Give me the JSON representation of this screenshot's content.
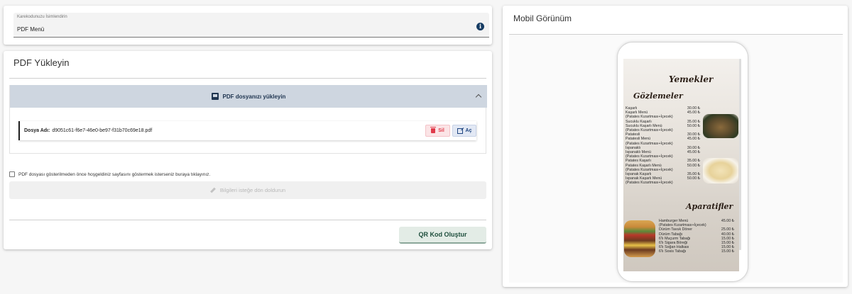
{
  "name_field": {
    "label": "Karekodunuzu İsimlendirin",
    "value": "PDF Menü"
  },
  "upload_card": {
    "title": "PDF Yükleyin",
    "accordion_label": "PDF dosyanızı yükleyin",
    "file_label": "Dosya Adı:",
    "file_name": "d9051c61-f6e7-46e0-be97-f31b70c69e18.pdf",
    "delete_label": "Sil",
    "open_label": "Aç",
    "checkbox_label": "PDF dosyası gösterilmeden önce hoşgeldiniz sayfasını göstermek isterseniz buraya tıklayınız.",
    "welcome_button_label": "Bilgileri isteğe dön doldurun",
    "qr_button_label": "QR Kod Oluştur"
  },
  "mobile_card": {
    "title": "Mobil Görünüm",
    "preview": {
      "heading_main": "Yemekler",
      "section1_title": "Gözlemeler",
      "section1_items": [
        {
          "name": "Kaşarlı",
          "price": "30.00 ₺"
        },
        {
          "name": "Kaşarlı Menü",
          "price": "45.00 ₺"
        },
        {
          "name": "(Patates Kızartması+İçecek)",
          "price": ""
        },
        {
          "name": "Sucuklu Kaşarlı",
          "price": "35.00 ₺"
        },
        {
          "name": "Sucuklu Kaşarlı Menü",
          "price": "50.00 ₺"
        },
        {
          "name": "(Patates Kızartması+İçecek)",
          "price": ""
        },
        {
          "name": "Patatesli",
          "price": "30.00 ₺"
        },
        {
          "name": "Patatesli Menü",
          "price": "45.00 ₺"
        },
        {
          "name": "(Patates Kızartması+İçecek)",
          "price": ""
        },
        {
          "name": "Ispanaklı",
          "price": "30.00 ₺"
        },
        {
          "name": "Ispanaklı Menü",
          "price": "45.00 ₺"
        },
        {
          "name": "(Patates Kızartması+İçecek)",
          "price": ""
        },
        {
          "name": "Patates Kaşarlı",
          "price": "35.00 ₺"
        },
        {
          "name": "Patates Kaşarlı Menü",
          "price": "50.00 ₺"
        },
        {
          "name": "(Patates Kızartması+İçecek)",
          "price": ""
        },
        {
          "name": "Ispanak Kaşarlı",
          "price": "35.00 ₺"
        },
        {
          "name": "Ispanak Kaşarlı Menü",
          "price": "50.00 ₺"
        },
        {
          "name": "(Patates Kızartması+İçecek)",
          "price": ""
        }
      ],
      "section2_title": "Aparatifler",
      "section2_items": [
        {
          "name": "Hamburger Menü",
          "price": "45.00 ₺"
        },
        {
          "name": "(Patates Kızartması+İçecek)",
          "price": ""
        },
        {
          "name": "Dürüm Tavuk Döner",
          "price": "25.00 ₺"
        },
        {
          "name": "Dürüm Tabağı",
          "price": "40.00 ₺"
        },
        {
          "name": "6'lı Muçurm Tabağı",
          "price": "15.00 ₺"
        },
        {
          "name": "6'lı Sigara Böreği",
          "price": "15.00 ₺"
        },
        {
          "name": "6'lı Soğan Halkası",
          "price": "15.00 ₺"
        },
        {
          "name": "6'lı Sosis Tabağı",
          "price": "15.00 ₺"
        }
      ]
    }
  }
}
